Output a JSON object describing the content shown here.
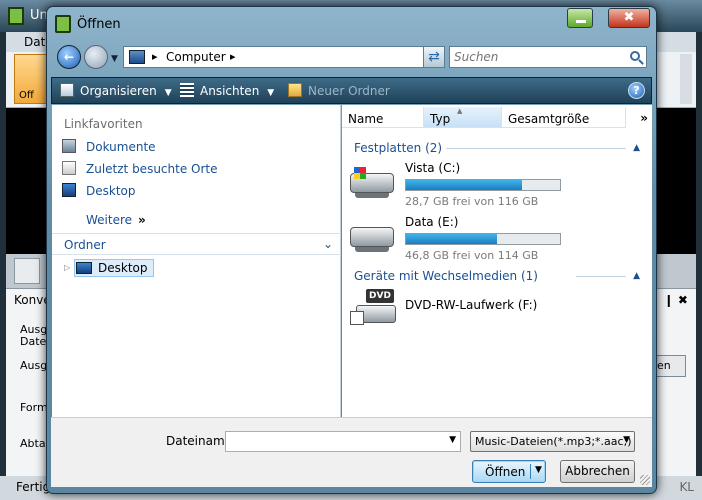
{
  "background_app": {
    "title": "Unk",
    "menu_first": "Dat",
    "file_button": "Off",
    "panel_title": "Konve",
    "panel_controls": "❙ ✖",
    "labels": [
      "Ausga",
      "Datei",
      "Ausga",
      "Form",
      "Abta"
    ],
    "right_button": "en",
    "status": "Fertig",
    "status_right": "KL"
  },
  "dialog": {
    "title": "Öffnen",
    "close_glyph": "✖",
    "address": {
      "crumb": "Computer",
      "separator": "▸",
      "drop_glyph": "▼"
    },
    "search": {
      "placeholder": "Suchen"
    },
    "toolbar": {
      "organize": "Organisieren",
      "views": "Ansichten",
      "new_folder": "Neuer Ordner",
      "caret": "▼",
      "help": "?"
    },
    "sidebar": {
      "favorites_title": "Linkfavoriten",
      "favorites": [
        "Dokumente",
        "Zuletzt besuchte Orte",
        "Desktop"
      ],
      "more": "Weitere",
      "more_glyph": "»",
      "folders_title": "Ordner",
      "folders_chev": "⌄",
      "tree_item": "Desktop"
    },
    "columns": [
      "Name",
      "Typ",
      "Gesamtgröße"
    ],
    "columns_more": "»",
    "groups": [
      {
        "title": "Festplatten (2)",
        "items": [
          {
            "name": "Vista (C:)",
            "free": "28,7 GB frei von 116 GB",
            "used_fraction": 0.75
          },
          {
            "name": "Data (E:)",
            "free": "46,8 GB frei von 114 GB",
            "used_fraction": 0.59
          }
        ]
      },
      {
        "title": "Geräte mit Wechselmedien (1)",
        "items": [
          {
            "name": "DVD-RW-Laufwerk (F:)",
            "badge": "DVD"
          }
        ]
      }
    ],
    "filename_label": "Dateiname:",
    "filename_value": "",
    "filter": "Music-Dateien(*.mp3;*.aac;)",
    "open_label": "Öffnen",
    "cancel_label": "Abbrechen"
  }
}
